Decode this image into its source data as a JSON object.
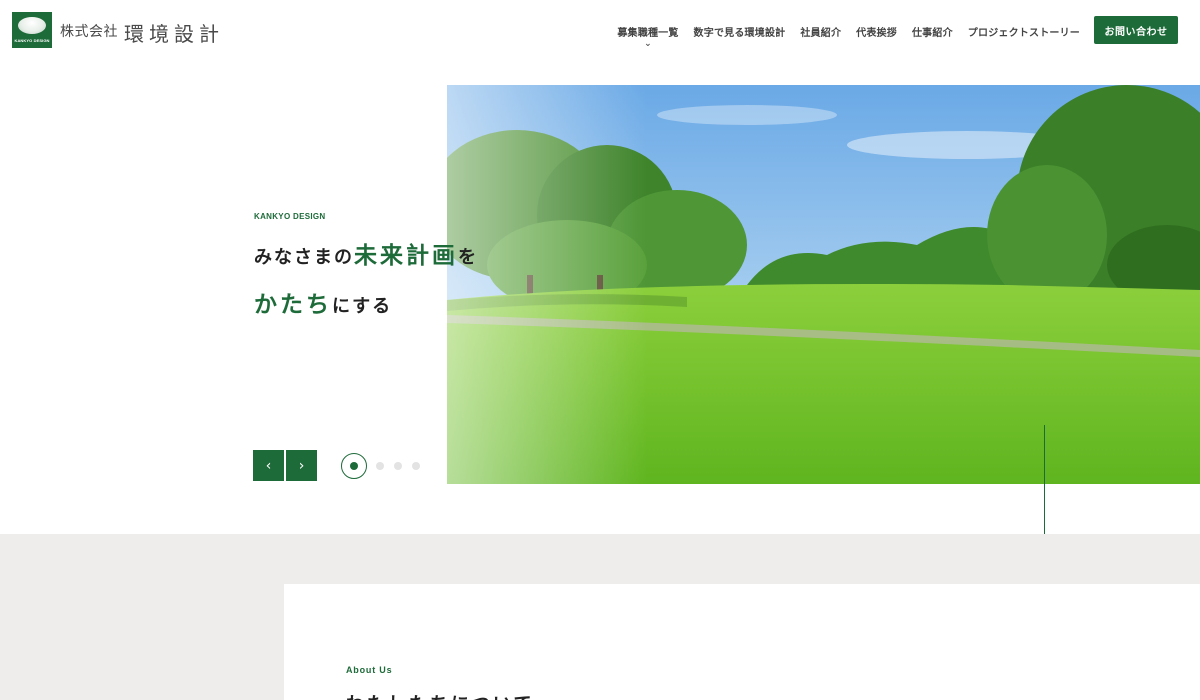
{
  "header": {
    "logo_text": "KANKYO DESIGN",
    "company_prefix": "株式会社",
    "company_name": "環境設計",
    "nav": [
      "募集職種一覧",
      "数字で見る環境設計",
      "社員紹介",
      "代表挨拶",
      "仕事紹介",
      "プロジェクトストーリー"
    ],
    "contact_label": "お問い合わせ"
  },
  "hero": {
    "kicker": "KANKYO DESIGN",
    "line1_pre": "みなさまの",
    "line1_em": "未来計画",
    "line1_post": "を",
    "line2_em": "かたち",
    "line2_post": "にする",
    "prev_label": "‹",
    "next_label": "›",
    "slide_count": 4,
    "active_slide": 1
  },
  "about": {
    "kicker": "About Us",
    "title": "わたしたちについて"
  },
  "colors": {
    "brand_green": "#1e6b3a",
    "section_bg": "#efedeb"
  },
  "icons": {
    "nav_dropdown": "chevron-down-icon",
    "slider_prev": "chevron-left-icon",
    "slider_next": "chevron-right-icon"
  }
}
